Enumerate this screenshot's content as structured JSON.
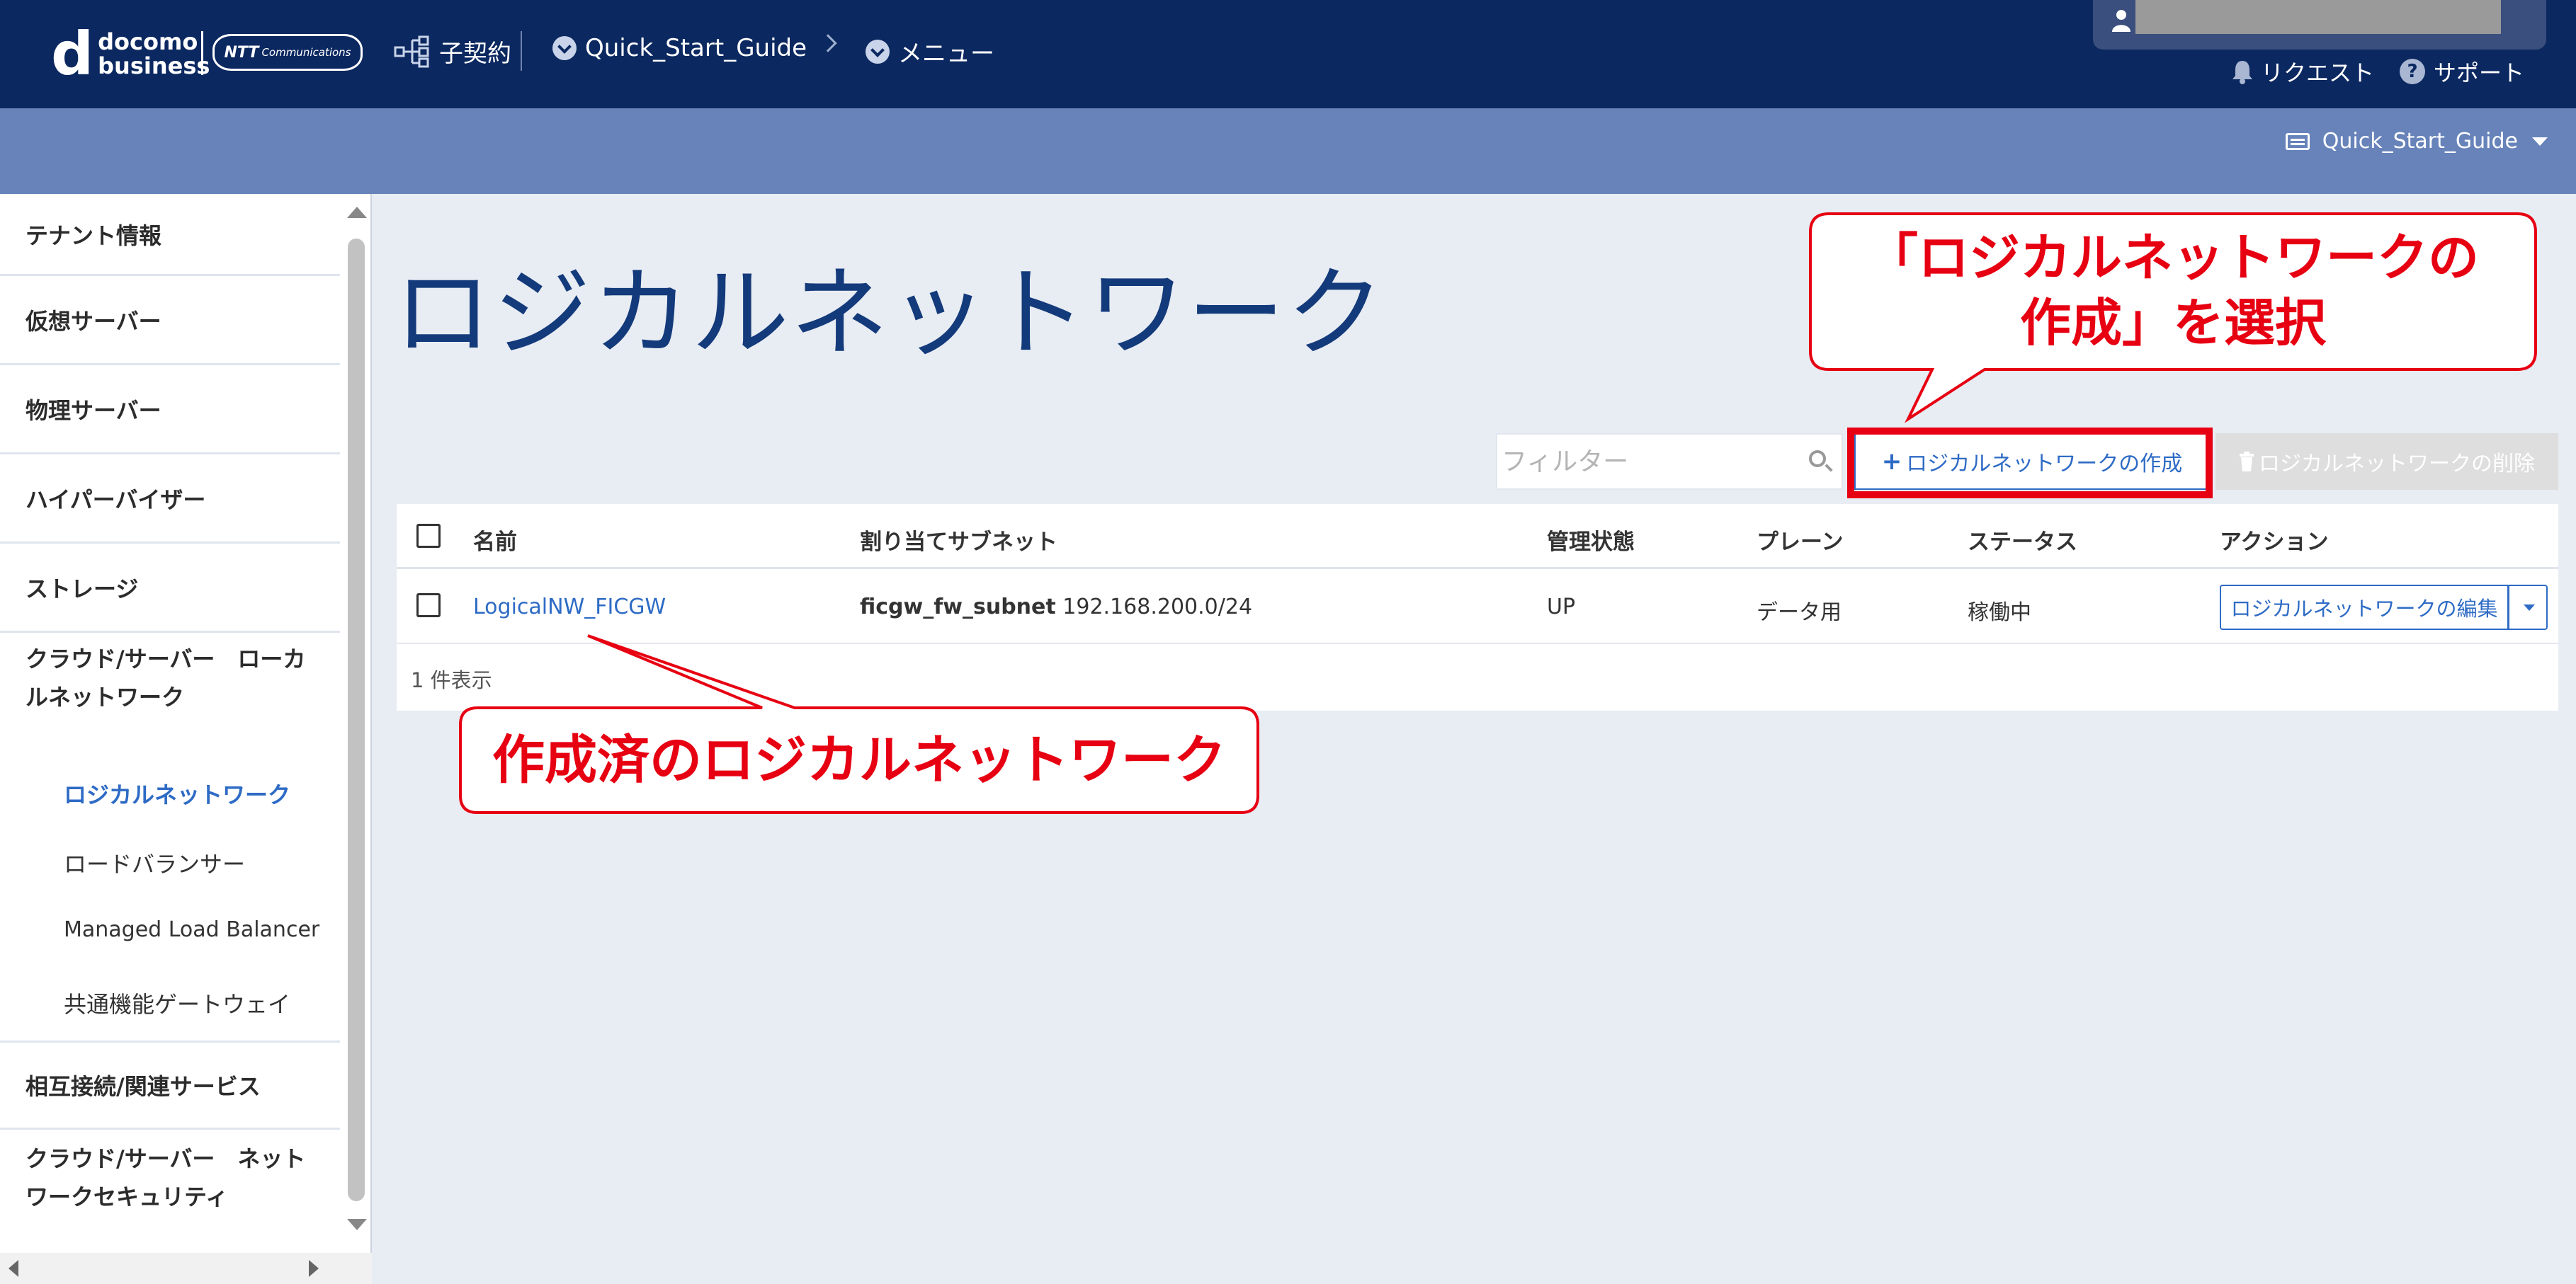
{
  "header": {
    "brand_top": "docomo",
    "brand_bottom": "business",
    "ntt_logo": "NTT",
    "ntt_logo_sub": "Communications",
    "contract_label": "子契約",
    "project_label": "Quick_Start_Guide",
    "menu_label": "メニュー",
    "request_label": "リクエスト",
    "support_label": "サポート",
    "project_selector": "Quick_Start_Guide"
  },
  "sidebar": {
    "items": [
      {
        "label": "テナント情報"
      },
      {
        "label": "仮想サーバー"
      },
      {
        "label": "物理サーバー"
      },
      {
        "label": "ハイパーバイザー"
      },
      {
        "label": "ストレージ"
      },
      {
        "label": "クラウド/サーバー　ローカルネットワーク"
      },
      {
        "label": "相互接続/関連サービス"
      },
      {
        "label": "クラウド/サーバー　ネットワークセキュリティ"
      }
    ],
    "subitems": [
      {
        "label": "ロジカルネットワーク",
        "active": true
      },
      {
        "label": "ロードバランサー"
      },
      {
        "label": "Managed Load Balancer"
      },
      {
        "label": "共通機能ゲートウェイ"
      }
    ]
  },
  "main": {
    "title": "ロジカルネットワーク",
    "filter_placeholder": "フィルター",
    "create_button": "ロジカルネットワークの作成",
    "delete_button": "ロジカルネットワークの削除",
    "columns": [
      "名前",
      "割り当てサブネット",
      "管理状態",
      "プレーン",
      "ステータス",
      "アクション"
    ],
    "rows": [
      {
        "name": "LogicalNW_FICGW",
        "subnet_name": "ficgw_fw_subnet",
        "subnet_cidr": "192.168.200.0/24",
        "admin_state": "UP",
        "plane": "データ用",
        "status": "稼働中",
        "action": "ロジカルネットワークの編集"
      }
    ],
    "count_text": "1 件表示"
  },
  "annotations": {
    "callout_top_line1": "「ロジカルネットワークの",
    "callout_top_line2": "作成」を選択",
    "callout_bottom": "作成済のロジカルネットワーク",
    "color": "#e60012"
  },
  "icons": [
    "user-icon",
    "bell-icon",
    "question-icon",
    "org-chart-icon",
    "chevron-circle-icon",
    "search-icon",
    "plus-icon",
    "trash-icon",
    "caret-down-icon"
  ]
}
